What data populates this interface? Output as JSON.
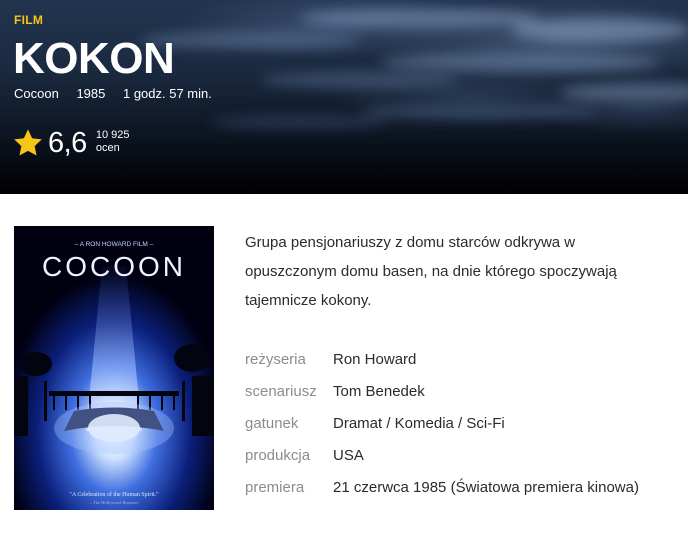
{
  "hero": {
    "type_label": "FILM",
    "title": "KOKON",
    "original_title": "Cocoon",
    "year": "1985",
    "duration": "1 godz. 57 min.",
    "rating": "6,6",
    "votes_count": "10 925",
    "votes_label": "ocen",
    "star_color": "#f5c518"
  },
  "poster": {
    "top_text": "– A RON HOWARD FILM –",
    "title_text": "COCOON",
    "tagline": "\"A Celebration of the Human Spirit.\"",
    "source": "– The Hollywood Reporter"
  },
  "description": "Grupa pensjonariuszy z domu starców odkrywa w opuszczonym domu basen, na dnie którego spoczywają tajemnicze kokony.",
  "details": [
    {
      "label": "reżyseria",
      "value": "Ron Howard"
    },
    {
      "label": "scenariusz",
      "value": "Tom Benedek"
    },
    {
      "label": "gatunek",
      "value": "Dramat / Komedia / Sci-Fi"
    },
    {
      "label": "produkcja",
      "value": "USA"
    },
    {
      "label": "premiera",
      "value": "21 czerwca 1985 (Światowa premiera kinowa)"
    }
  ]
}
